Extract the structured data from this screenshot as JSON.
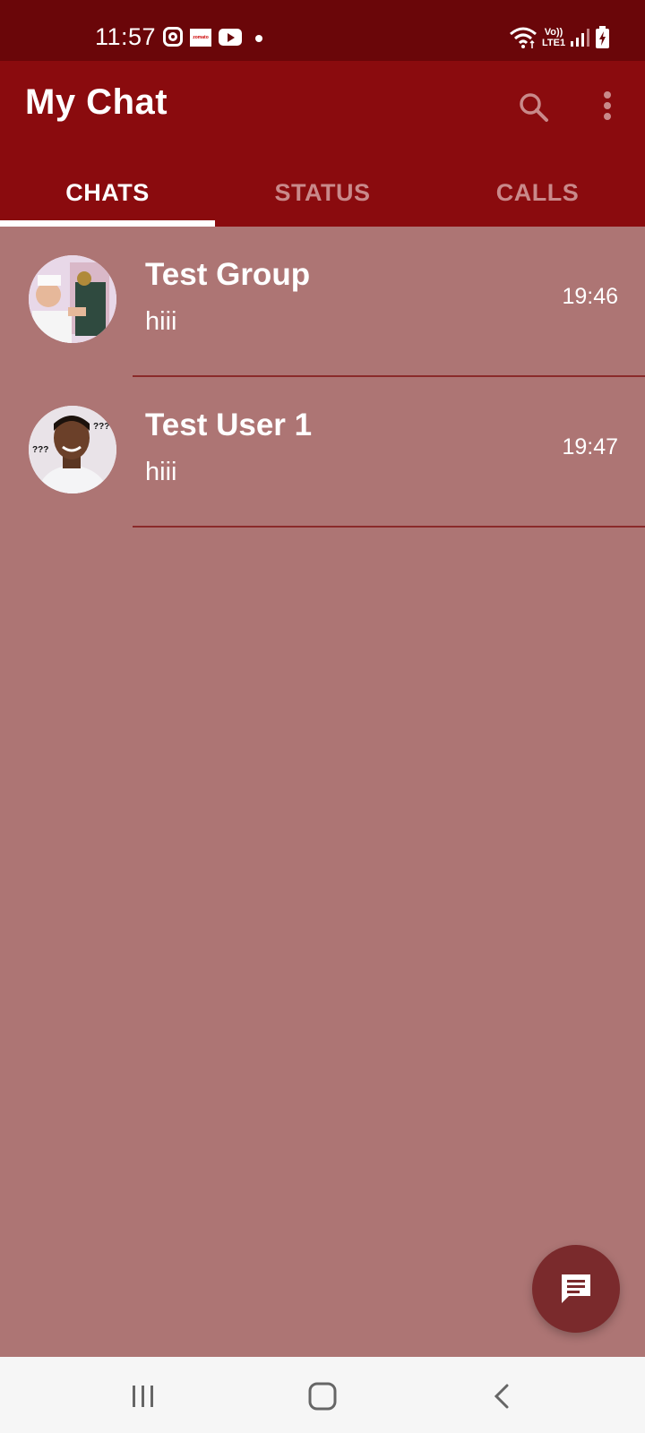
{
  "status_bar": {
    "time": "11:57",
    "icons": [
      "instagram-icon",
      "zomato-icon",
      "youtube-icon",
      "notification-dot-icon",
      "wifi-icon",
      "volte-icon",
      "signal-icon",
      "battery-charging-icon"
    ],
    "zomato_label": "zomato",
    "volte_top": "Vo))",
    "volte_bottom": "LTE1"
  },
  "app_bar": {
    "title": "My Chat",
    "icons": [
      "search-icon",
      "more-vert-icon"
    ]
  },
  "tabs": [
    {
      "label": "CHATS",
      "active": true
    },
    {
      "label": "STATUS",
      "active": false
    },
    {
      "label": "CALLS",
      "active": false
    }
  ],
  "chats": [
    {
      "name": "Test Group",
      "last_message": "hiii",
      "time": "19:46"
    },
    {
      "name": "Test User 1",
      "last_message": "hiii",
      "time": "19:47"
    }
  ],
  "avatar_overlay_text": "???",
  "fab": {
    "icon": "message-icon"
  },
  "nav_bar": {
    "icons": [
      "recents-icon",
      "home-icon",
      "back-icon"
    ]
  },
  "colors": {
    "status_bar": "#6a0609",
    "app_bar": "#8a0b0e",
    "background": "#ad7574",
    "fab": "#7a2a2c",
    "divider": "#8a2a2a"
  }
}
